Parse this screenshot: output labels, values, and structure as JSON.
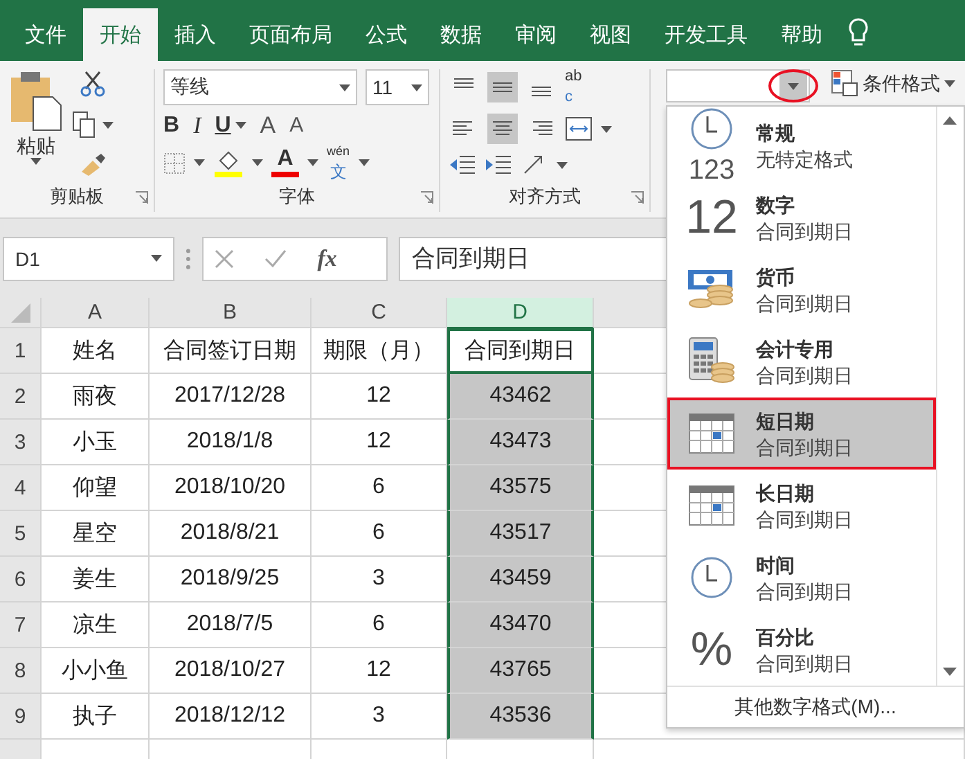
{
  "tabs": [
    {
      "label": "文件",
      "selected": false
    },
    {
      "label": "开始",
      "selected": true
    },
    {
      "label": "插入",
      "selected": false
    },
    {
      "label": "页面布局",
      "selected": false
    },
    {
      "label": "公式",
      "selected": false
    },
    {
      "label": "数据",
      "selected": false
    },
    {
      "label": "审阅",
      "selected": false
    },
    {
      "label": "视图",
      "selected": false
    },
    {
      "label": "开发工具",
      "selected": false
    },
    {
      "label": "帮助",
      "selected": false
    }
  ],
  "ribbon": {
    "clipboard": {
      "paste": "粘贴",
      "label": "剪贴板"
    },
    "font": {
      "name": "等线",
      "size": "11",
      "bold": "B",
      "italic": "I",
      "underline": "U",
      "grow": "A",
      "shrink": "A",
      "color_letter": "A",
      "phonetic_top": "wén",
      "phonetic_bottom": "文",
      "label": "字体"
    },
    "alignment": {
      "wrap_top": "ab",
      "wrap_bottom": "c",
      "label": "对齐方式"
    },
    "conditional": "条件格式"
  },
  "formula_bar": {
    "name_box": "D1",
    "fx": "fx",
    "value": "合同到期日"
  },
  "sheet": {
    "columns": [
      {
        "label": "A",
        "selected": false
      },
      {
        "label": "B",
        "selected": false
      },
      {
        "label": "C",
        "selected": false
      },
      {
        "label": "D",
        "selected": true
      }
    ],
    "rows": [
      {
        "number": "1",
        "cells": [
          "姓名",
          "合同签订日期",
          "期限（月）",
          "合同到期日"
        ]
      },
      {
        "number": "2",
        "cells": [
          "雨夜",
          "2017/12/28",
          "12",
          "43462"
        ]
      },
      {
        "number": "3",
        "cells": [
          "小玉",
          "2018/1/8",
          "12",
          "43473"
        ]
      },
      {
        "number": "4",
        "cells": [
          "仰望",
          "2018/10/20",
          "6",
          "43575"
        ]
      },
      {
        "number": "5",
        "cells": [
          "星空",
          "2018/8/21",
          "6",
          "43517"
        ]
      },
      {
        "number": "6",
        "cells": [
          "姜生",
          "2018/9/25",
          "3",
          "43459"
        ]
      },
      {
        "number": "7",
        "cells": [
          "凉生",
          "2018/7/5",
          "6",
          "43470"
        ]
      },
      {
        "number": "8",
        "cells": [
          "小小鱼",
          "2018/10/27",
          "12",
          "43765"
        ]
      },
      {
        "number": "9",
        "cells": [
          "执子",
          "2018/12/12",
          "3",
          "43536"
        ]
      }
    ]
  },
  "format_menu": {
    "items": [
      {
        "kind": "general",
        "icon_text": "123",
        "title": "常规",
        "preview": "无特定格式",
        "selected": false
      },
      {
        "kind": "number",
        "icon_text": "12",
        "title": "数字",
        "preview": "合同到期日",
        "selected": false
      },
      {
        "kind": "currency",
        "title": "货币",
        "preview": "合同到期日",
        "selected": false
      },
      {
        "kind": "accounting",
        "title": "会计专用",
        "preview": "合同到期日",
        "selected": false
      },
      {
        "kind": "short_date",
        "title": "短日期",
        "preview": "合同到期日",
        "selected": true
      },
      {
        "kind": "long_date",
        "title": "长日期",
        "preview": "合同到期日",
        "selected": false
      },
      {
        "kind": "time",
        "title": "时间",
        "preview": "合同到期日",
        "selected": false
      },
      {
        "kind": "percent",
        "icon_text": "%",
        "title": "百分比",
        "preview": "合同到期日",
        "selected": false
      }
    ],
    "more": "其他数字格式(M)..."
  }
}
